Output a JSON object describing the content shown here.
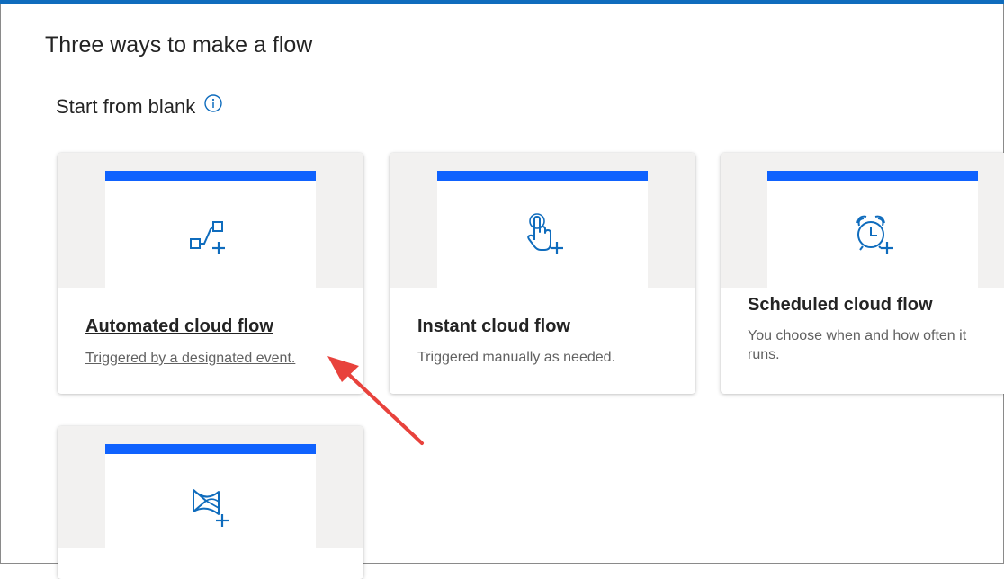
{
  "page": {
    "title": "Three ways to make a flow"
  },
  "section": {
    "title": "Start from blank"
  },
  "cards": [
    {
      "title": "Automated cloud flow",
      "description": "Triggered by a designated event.",
      "icon": "automated-flow-icon"
    },
    {
      "title": "Instant cloud flow",
      "description": "Triggered manually as needed.",
      "icon": "touch-flow-icon"
    },
    {
      "title": "Scheduled cloud flow",
      "description": "You choose when and how often it runs.",
      "icon": "alarm-clock-icon"
    },
    {
      "title": "",
      "description": "",
      "icon": "desktop-flow-icon"
    }
  ],
  "colors": {
    "accent": "#0f62fe",
    "icon": "#0f6cbd",
    "annotation_arrow": "#e8423c"
  }
}
